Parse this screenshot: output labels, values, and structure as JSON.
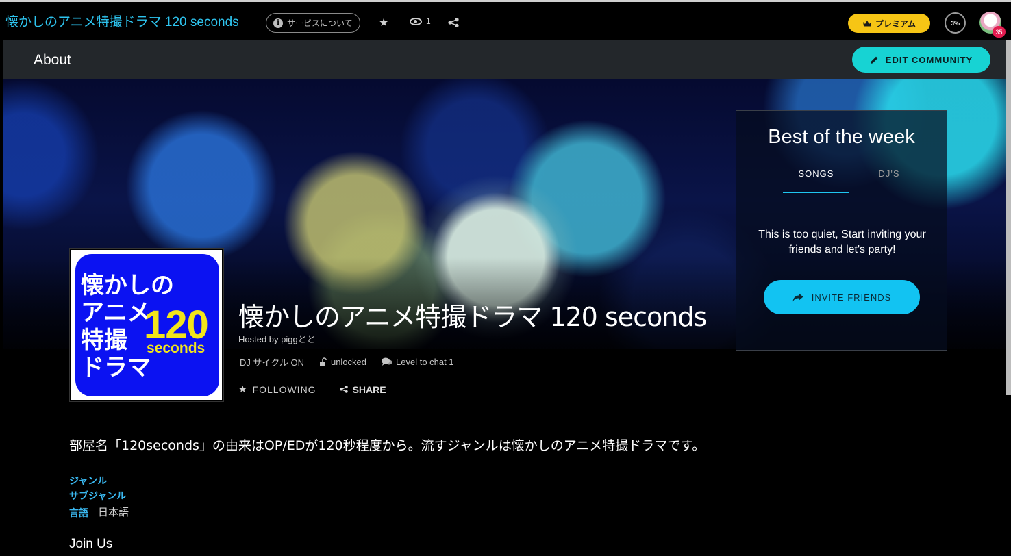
{
  "topbar": {
    "app_title": "懐かしのアニメ特撮ドラマ 120 seconds",
    "about_label": "サービスについて",
    "view_count": "1",
    "premium_label": "プレミアム",
    "percent_label": "3%",
    "notification_count": "35"
  },
  "subheader": {
    "title": "About",
    "edit_label": "EDIT COMMUNITY"
  },
  "room": {
    "title": "懐かしのアニメ特撮ドラマ 120 seconds",
    "hosted_by": "Hosted by piggとと",
    "dj_cycle": "DJ サイクル ON",
    "lock_status": "unlocked",
    "chat_level": "Level to chat 1",
    "follow_label": "FOLLOWING",
    "share_label": "SHARE",
    "cover": {
      "line1": "懐かしの",
      "line2": "アニメ",
      "line3": "特撮",
      "line4": "ドラマ",
      "number": "120",
      "unit": "seconds"
    }
  },
  "best_of_week": {
    "title": "Best of the week",
    "tabs": [
      "SONGS",
      "DJ'S"
    ],
    "empty_message": "This is too quiet, Start inviting your friends and let's party!",
    "invite_label": "INVITE FRIENDS"
  },
  "details": {
    "description": "部屋名「120seconds」の由来はOP/EDが120秒程度から。流すジャンルは懐かしのアニメ特撮ドラマです。",
    "genre_label": "ジャンル",
    "subgenre_label": "サブジャンル",
    "language_label": "言語",
    "language_value": "日本語",
    "join_heading": "Join Us"
  },
  "colors": {
    "accent": "#12c3f2",
    "teal_button": "#17d3d3",
    "premium": "#f6c515",
    "badge": "#e21c4f"
  }
}
